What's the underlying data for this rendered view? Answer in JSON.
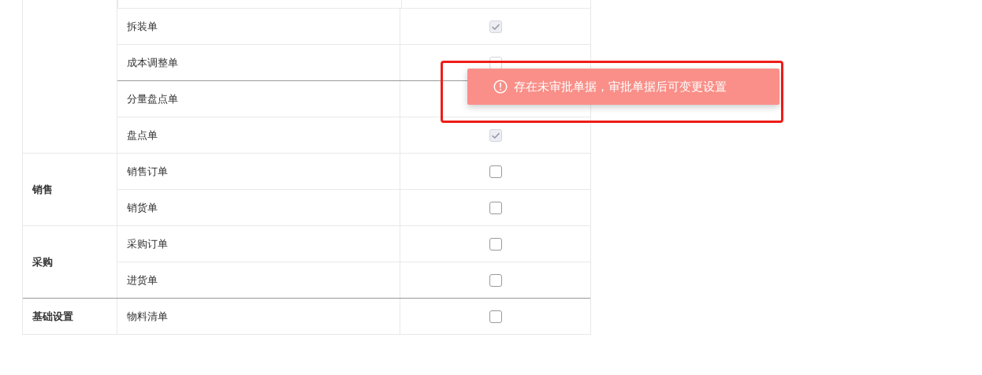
{
  "groups": [
    {
      "rows": [
        {
          "name": "拆装单",
          "checkbox": {
            "checked": true,
            "disabled": true
          },
          "strong_bottom_border": false
        },
        {
          "name": "成本调整单",
          "checkbox": {
            "disabled": true
          },
          "strong_bottom_border": true
        },
        {
          "name": "分量盘点单",
          "strong_bottom_border": false
        },
        {
          "name": "盘点单",
          "checkbox": {
            "checked": true,
            "disabled": true
          },
          "strong_bottom_border": false
        }
      ]
    },
    {
      "category": "销售",
      "rows": [
        {
          "name": "销售订单",
          "checkbox": {
            "checked": false,
            "disabled": false
          },
          "strong_bottom_border": false
        },
        {
          "name": "销货单",
          "checkbox": {
            "checked": false,
            "disabled": false
          },
          "strong_bottom_border": false
        }
      ]
    },
    {
      "category": "采购",
      "rows": [
        {
          "name": "采购订单",
          "checkbox": {
            "checked": false,
            "disabled": false
          },
          "strong_bottom_border": false
        },
        {
          "name": "进货单",
          "checkbox": {
            "checked": false,
            "disabled": false
          },
          "strong_bottom_border": true
        }
      ]
    },
    {
      "category": "基础设置",
      "rows": [
        {
          "name": "物料清单",
          "checkbox": {
            "checked": false,
            "disabled": false
          },
          "strong_bottom_border": false
        }
      ]
    }
  ],
  "toast": {
    "message": "存在未审批单据，审批单据后可变更设置",
    "highlighted": true
  }
}
